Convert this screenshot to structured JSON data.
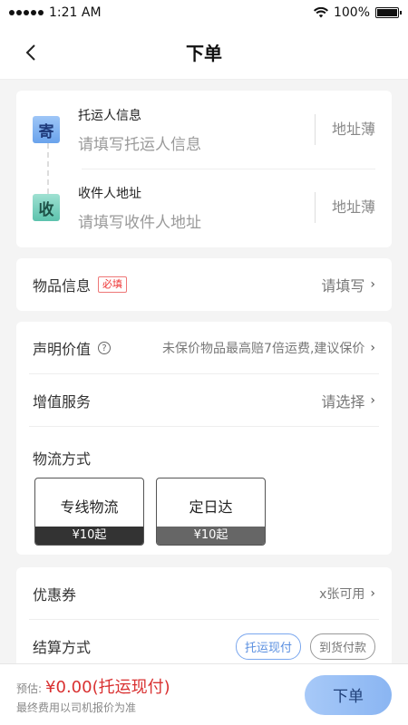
{
  "status": {
    "time": "1:21 AM",
    "battery": "100%",
    "battery_level": 1.0
  },
  "nav": {
    "title": "下单"
  },
  "sender": {
    "title": "托运人信息",
    "placeholder": "请填写托运人信息",
    "address_book": "地址薄",
    "badge": "寄"
  },
  "receiver": {
    "title": "收件人地址",
    "placeholder": "请填写收件人地址",
    "address_book": "地址薄",
    "badge": "收"
  },
  "goods": {
    "label": "物品信息",
    "required": "必填",
    "value": "请填写"
  },
  "declared": {
    "label": "声明价值",
    "help": "?",
    "value": "未保价物品最高赔7倍运费,建议保价"
  },
  "value_added": {
    "label": "增值服务",
    "value": "请选择"
  },
  "logistics": {
    "title": "物流方式",
    "options": [
      {
        "name": "专线物流",
        "price": "¥10起"
      },
      {
        "name": "定日达",
        "price": "¥10起"
      }
    ]
  },
  "coupon": {
    "label": "优惠券",
    "value": "x张可用"
  },
  "settlement": {
    "label": "结算方式",
    "options": [
      "托运现付",
      "到货付款"
    ],
    "selected": "托运现付"
  },
  "footer": {
    "est_label": "预估:",
    "amount": "¥0.00",
    "method": "(托运现付)",
    "note": "最终费用以司机报价为准",
    "submit": "下单"
  },
  "colors": {
    "price_red": "#d93131",
    "accent_blue": "#7aa7ee"
  },
  "icons": {
    "back": "chevron-left-icon",
    "wifi": "wifi-icon",
    "battery": "battery-icon",
    "chevron": "chevron-right-icon",
    "help": "question-circle-icon"
  }
}
